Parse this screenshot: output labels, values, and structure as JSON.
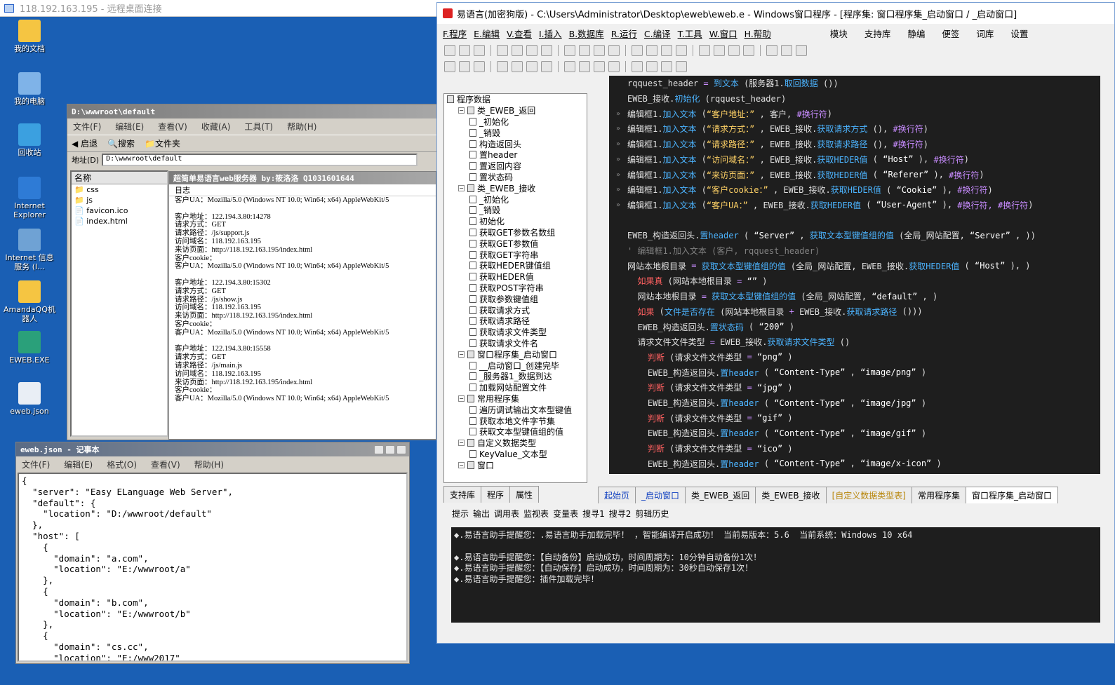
{
  "rdp": {
    "title": "118.192.163.195 - 远程桌面连接"
  },
  "desktop": {
    "icons": [
      "我的文档",
      "我的电脑",
      "回收站",
      "Internet Explorer",
      "Internet 信息服务 (I...",
      "AmandaQQ机器人",
      "EWEB.EXE",
      "eweb.json"
    ]
  },
  "explorer": {
    "title": "D:\\wwwroot\\default",
    "menu": [
      "文件(F)",
      "编辑(E)",
      "查看(V)",
      "收藏(A)",
      "工具(T)",
      "帮助(H)"
    ],
    "toolbar": [
      "启退",
      "搜索",
      "文件夹"
    ],
    "address_label": "地址(D)",
    "address": "D:\\wwwroot\\default",
    "col_name": "名称",
    "files": [
      "css",
      "js",
      "favicon.ico",
      "index.html"
    ]
  },
  "server": {
    "title": "超简单易语言web服务器 by:筱洛洛 Q1031601644",
    "log_label": "日志",
    "lines": [
      "客户UA：Mozilla/5.0 (Windows NT 10.0; Win64; x64) AppleWebKit/5",
      "",
      "客户地址：122.194.3.80:14278",
      "请求方式：GET",
      "请求路径：/js/support.js",
      "访问域名：118.192.163.195",
      "来访页面：http://118.192.163.195/index.html",
      "客户cookie：",
      "客户UA：Mozilla/5.0 (Windows NT 10.0; Win64; x64) AppleWebKit/5",
      "",
      "客户地址：122.194.3.80:15302",
      "请求方式：GET",
      "请求路径：/js/show.js",
      "访问域名：118.192.163.195",
      "来访页面：http://118.192.163.195/index.html",
      "客户cookie：",
      "客户UA：Mozilla/5.0 (Windows NT 10.0; Win64; x64) AppleWebKit/5",
      "",
      "客户地址：122.194.3.80:15558",
      "请求方式：GET",
      "请求路径：/js/main.js",
      "访问域名：118.192.163.195",
      "来访页面：http://118.192.163.195/index.html",
      "客户cookie：",
      "客户UA：Mozilla/5.0 (Windows NT 10.0; Win64; x64) AppleWebKit/5"
    ]
  },
  "notepad": {
    "title": "eweb.json - 记事本",
    "menu": [
      "文件(F)",
      "编辑(E)",
      "格式(O)",
      "查看(V)",
      "帮助(H)"
    ],
    "lines": [
      "{",
      "  \"server\": \"Easy ELanguage Web Server\",",
      "  \"default\": {",
      "    \"location\": \"D:/wwwroot/default\"",
      "  },",
      "  \"host\": [",
      "    {",
      "      \"domain\": \"a.com\",",
      "      \"location\": \"E:/wwwroot/a\"",
      "    },",
      "    {",
      "      \"domain\": \"b.com\",",
      "      \"location\": \"E:/wwwroot/b\"",
      "    },",
      "    {",
      "      \"domain\": \"cs.cc\",",
      "      \"location\": \"E:/www2017\""
    ]
  },
  "ide": {
    "title": "易语言(加密狗版) - C:\\Users\\Administrator\\Desktop\\eweb\\eweb.e - Windows窗口程序 - [程序集: 窗口程序集_启动窗口 / _启动窗口]",
    "menu": [
      "F.程序",
      "E.编辑",
      "V.查看",
      "I.插入",
      "B.数据库",
      "R.运行",
      "C.编译",
      "T.工具",
      "W.窗口",
      "H.帮助"
    ],
    "menu_right": [
      "模块",
      "支持库",
      "静编",
      "便签",
      "词库",
      "设置"
    ],
    "tree": [
      {
        "d": 0,
        "t": "程序数据",
        "b": ""
      },
      {
        "d": 1,
        "t": "类_EWEB_返回",
        "b": "-"
      },
      {
        "d": 2,
        "t": "_初始化",
        "b": ""
      },
      {
        "d": 2,
        "t": "_销毁",
        "b": ""
      },
      {
        "d": 2,
        "t": "构造返回头",
        "b": ""
      },
      {
        "d": 2,
        "t": "置header",
        "b": ""
      },
      {
        "d": 2,
        "t": "置返回内容",
        "b": ""
      },
      {
        "d": 2,
        "t": "置状态码",
        "b": ""
      },
      {
        "d": 1,
        "t": "类_EWEB_接收",
        "b": "-"
      },
      {
        "d": 2,
        "t": "_初始化",
        "b": ""
      },
      {
        "d": 2,
        "t": "_销毁",
        "b": ""
      },
      {
        "d": 2,
        "t": "初始化",
        "b": ""
      },
      {
        "d": 2,
        "t": "获取GET参数名数组",
        "b": ""
      },
      {
        "d": 2,
        "t": "获取GET参数值",
        "b": ""
      },
      {
        "d": 2,
        "t": "获取GET字符串",
        "b": ""
      },
      {
        "d": 2,
        "t": "获取HEDER键值组",
        "b": ""
      },
      {
        "d": 2,
        "t": "获取HEDER值",
        "b": ""
      },
      {
        "d": 2,
        "t": "获取POST字符串",
        "b": ""
      },
      {
        "d": 2,
        "t": "获取参数键值组",
        "b": ""
      },
      {
        "d": 2,
        "t": "获取请求方式",
        "b": ""
      },
      {
        "d": 2,
        "t": "获取请求路径",
        "b": ""
      },
      {
        "d": 2,
        "t": "获取请求文件类型",
        "b": ""
      },
      {
        "d": 2,
        "t": "获取请求文件名",
        "b": ""
      },
      {
        "d": 1,
        "t": "窗口程序集_启动窗口",
        "b": "-"
      },
      {
        "d": 2,
        "t": "__启动窗口_创建完毕",
        "b": ""
      },
      {
        "d": 2,
        "t": "_服务器1_数据到达",
        "b": ""
      },
      {
        "d": 2,
        "t": "加载网站配置文件",
        "b": ""
      },
      {
        "d": 1,
        "t": "常用程序集",
        "b": "-"
      },
      {
        "d": 2,
        "t": "遍历调试输出文本型键值",
        "b": ""
      },
      {
        "d": 2,
        "t": "获取本地文件字节集",
        "b": ""
      },
      {
        "d": 2,
        "t": "获取文本型键值组的值",
        "b": ""
      },
      {
        "d": 1,
        "t": "自定义数据类型",
        "b": "-"
      },
      {
        "d": 2,
        "t": "KeyValue_文本型",
        "b": ""
      },
      {
        "d": 1,
        "t": "窗口",
        "b": "-"
      }
    ],
    "tree_tabs": [
      "支持库",
      "程序",
      "属性"
    ],
    "code_tabs": [
      "起始页",
      "_启动窗口",
      "类_EWEB_返回",
      "类_EWEB_接收",
      "[自定义数据类型表]",
      "常用程序集",
      "窗口程序集_启动窗口"
    ],
    "out_tabs": [
      "提示",
      "输出",
      "调用表",
      "监视表",
      "变量表",
      "搜寻1",
      "搜寻2",
      "剪辑历史"
    ],
    "output": [
      "◆.易语言助手提醒您：.易语言助手加载完毕！ ，智能编译开启成功！ 当前易版本：5.6  当前系统：Windows 10 x64",
      "",
      "◆.易语言助手提醒您：【自动备份】启动成功，时间周期为：10分钟自动备份1次！",
      "◆.易语言助手提醒您：【自动保存】启动成功，时间周期为：30秒自动保存1次！",
      "◆.易语言助手提醒您：插件加载完毕！"
    ]
  }
}
